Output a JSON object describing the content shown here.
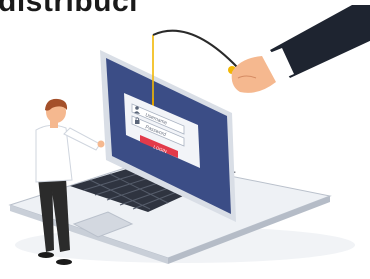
{
  "headline": {
    "text": "distribuci"
  },
  "login_form": {
    "username_placeholder": "Username",
    "password_placeholder": "Password",
    "button_label": "LOGIN"
  },
  "colors": {
    "screen_background": "#3b4d86",
    "form_card": "#f2f4f8",
    "login_button": "#e23a4a",
    "keyboard_base": "#dfe3ea",
    "suit": "#1e2430",
    "hand": "#f5b88f",
    "fishing_rod": "#2a2a2a",
    "person_shirt": "#ffffff",
    "person_pants": "#2b2b2b",
    "person_hair": "#a4502a"
  },
  "icons": [
    "hook-icon",
    "user-icon",
    "lock-icon"
  ]
}
